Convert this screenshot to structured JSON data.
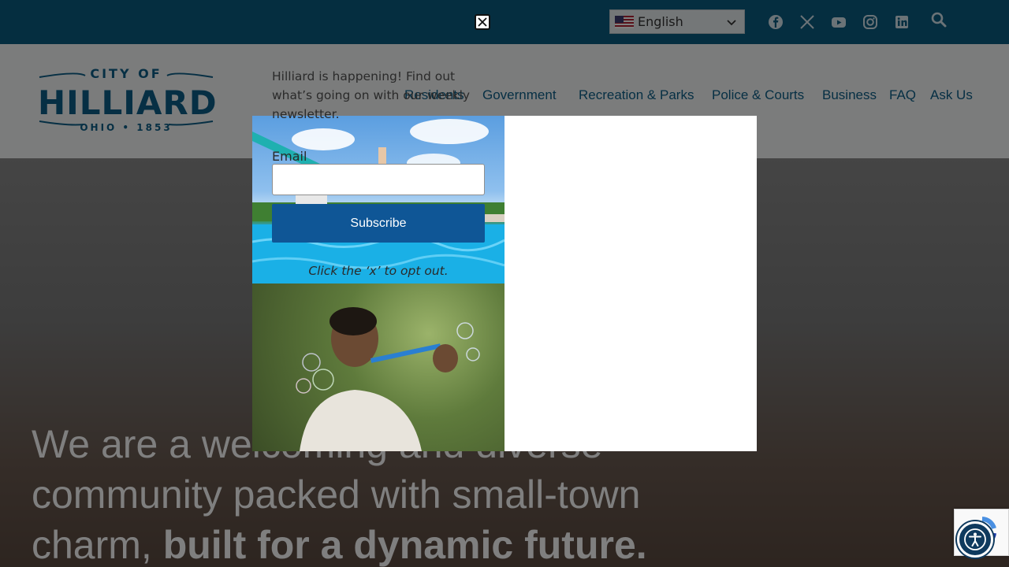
{
  "topbar": {
    "language": "English",
    "social": [
      "facebook-icon",
      "x-twitter-icon",
      "youtube-icon",
      "instagram-icon",
      "linkedin-icon"
    ],
    "search_icon": "search-icon"
  },
  "logo": {
    "top_text": "CITY OF",
    "name": "HILLIARD",
    "bottom_text": "OHIO • 1853"
  },
  "nav": {
    "items": [
      "Residents",
      "Government",
      "Recreation & Parks",
      "Police & Courts",
      "Business",
      "FAQ",
      "Ask Us"
    ]
  },
  "hero": {
    "line_plain": "We are a welcoming and diverse community packed with small-town charm, ",
    "line_bold": "built for a dynamic future."
  },
  "modal": {
    "intro": "Hilliard is happening! Find out what’s going on with our weekly newsletter.",
    "email_label": "Email",
    "email_value": "",
    "subscribe_label": "Subscribe",
    "optout": "Click the ‘x’ to opt out.",
    "close_icon": "close-icon"
  },
  "colors": {
    "topbar": "#0b5c80",
    "brand_blue": "#0d5f88",
    "button": "#0f5696",
    "accessibility": "#0f3a5e"
  }
}
